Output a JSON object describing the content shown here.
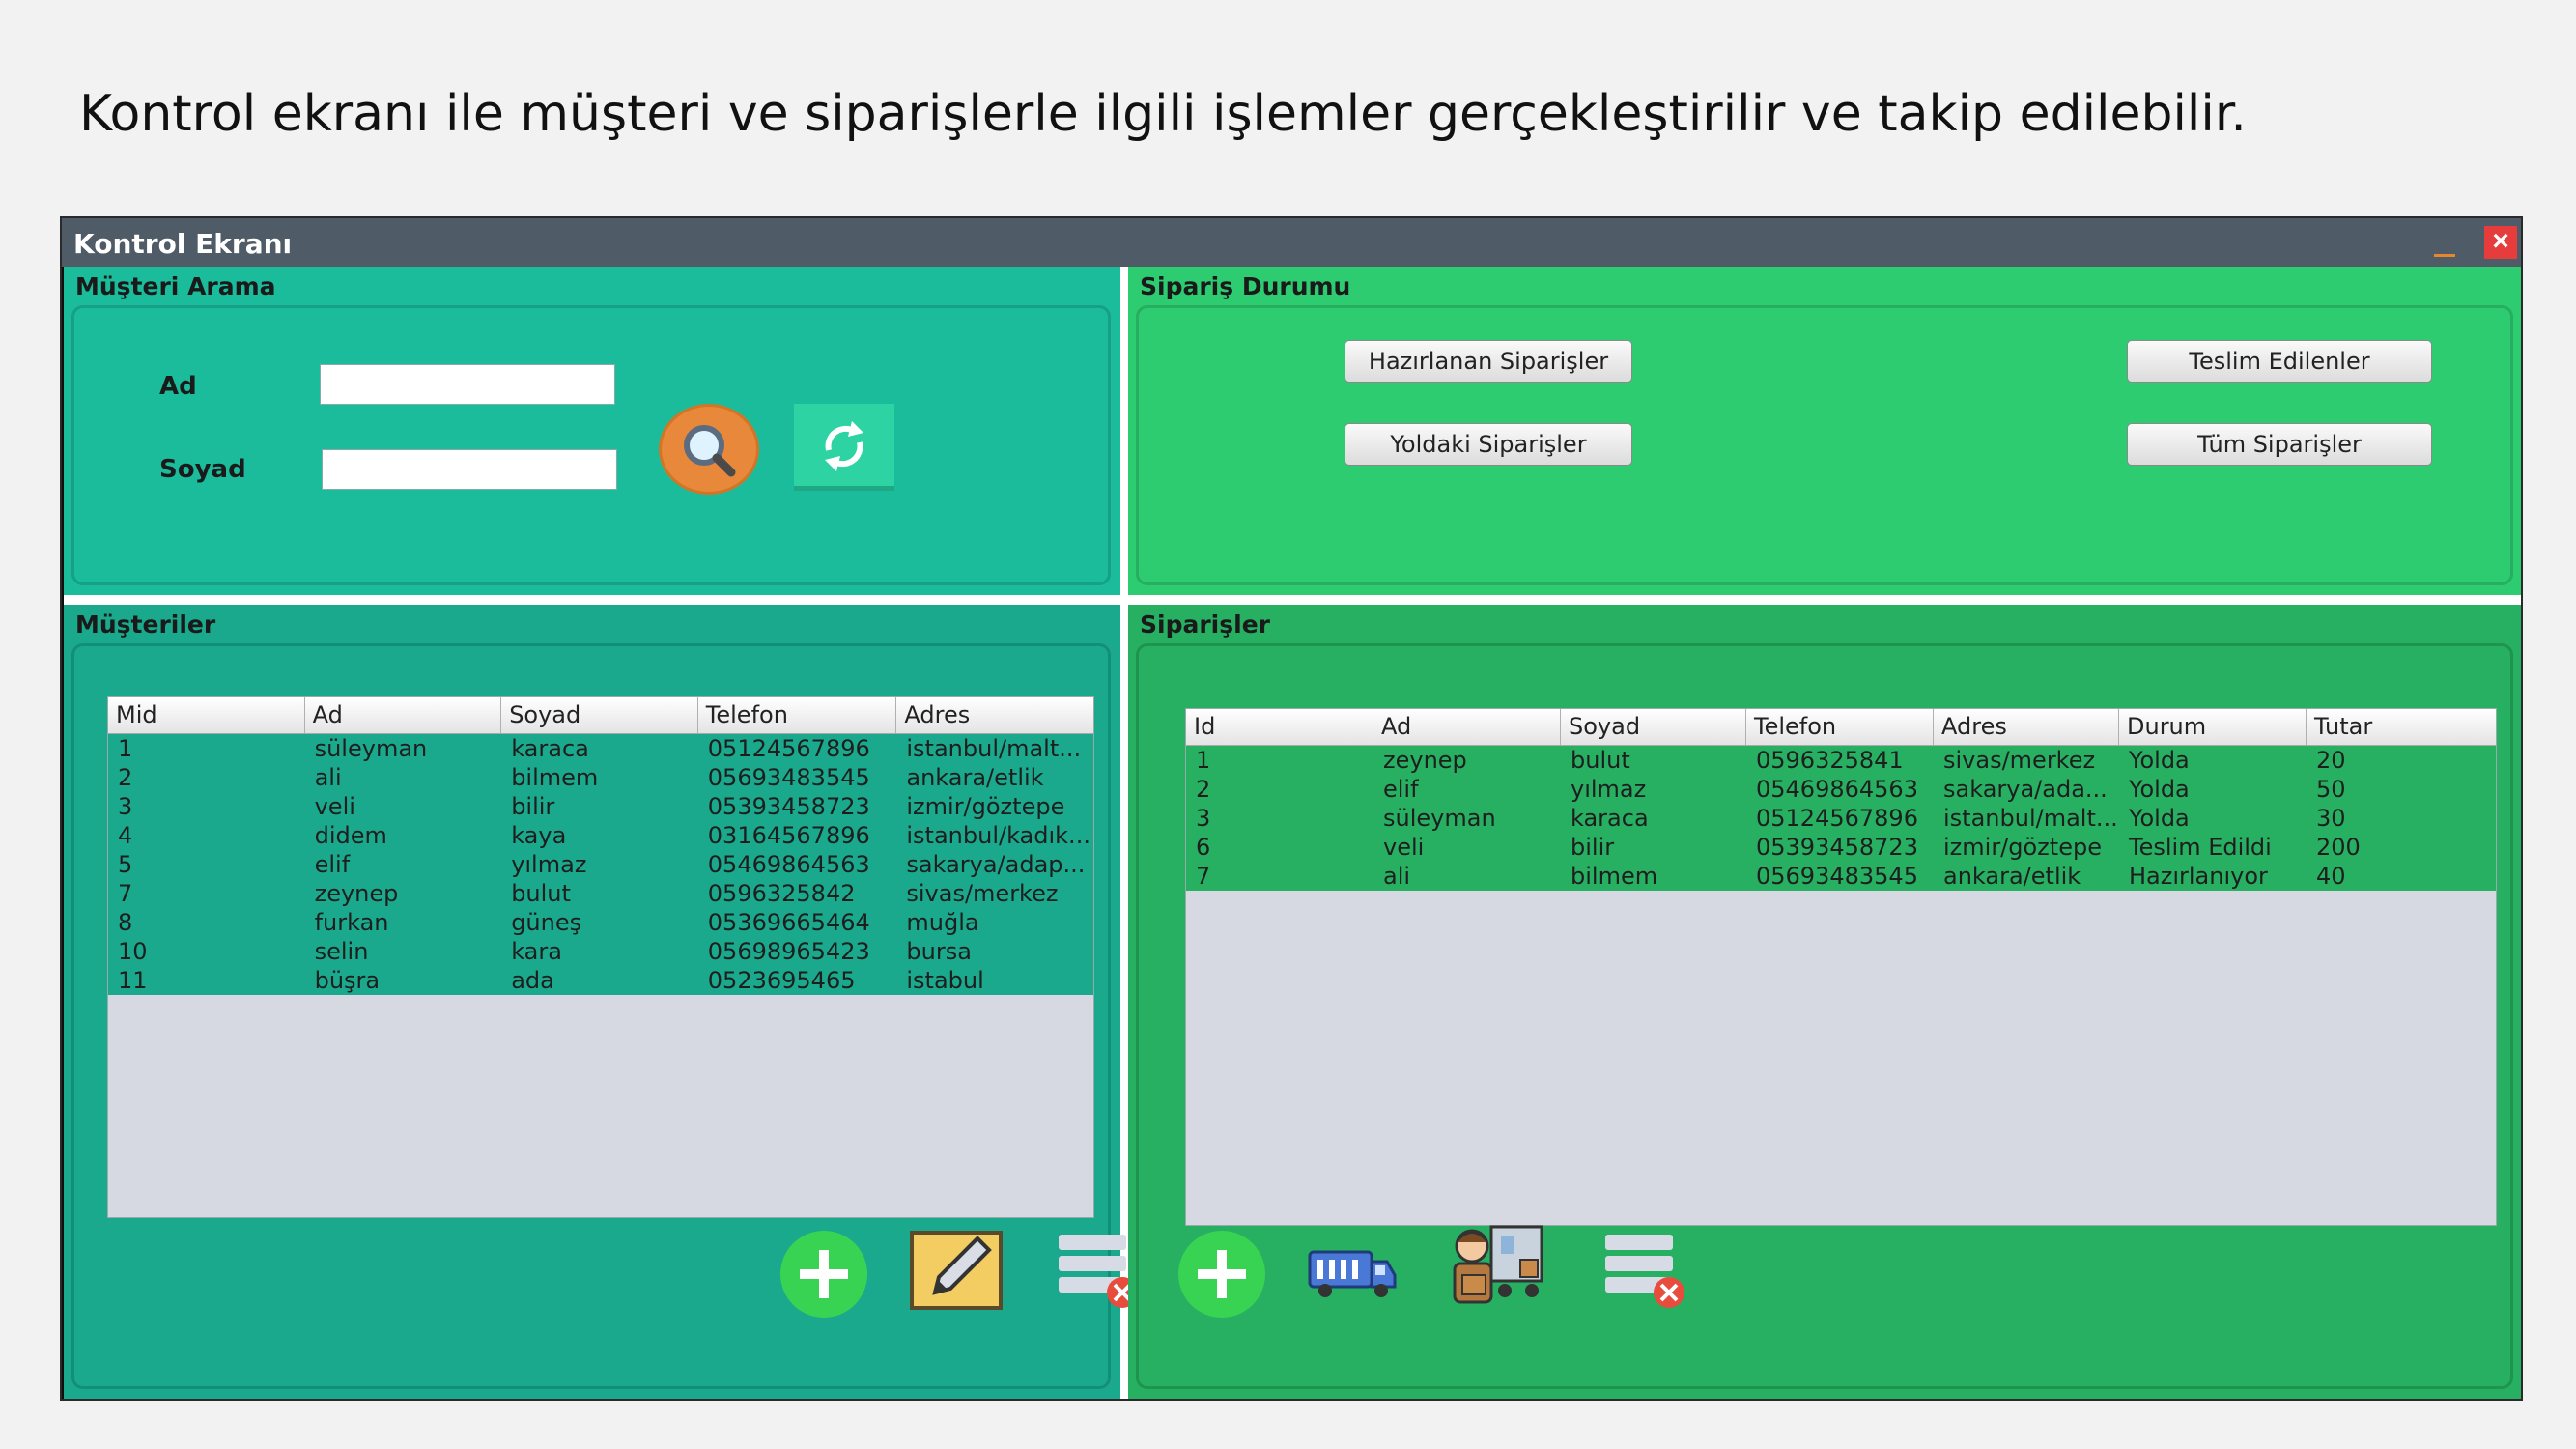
{
  "caption": "Kontrol ekranı ile müşteri ve siparişlerle ilgili işlemler gerçekleştirilir ve takip edilebilir.",
  "window": {
    "title": "Kontrol Ekranı",
    "close_label": "×"
  },
  "search_panel": {
    "title": "Müşteri Arama",
    "ad_label": "Ad",
    "soyad_label": "Soyad",
    "ad_value": "",
    "soyad_value": "",
    "search_icon": "magnifier-icon",
    "refresh_icon": "refresh-icon"
  },
  "status_panel": {
    "title": "Sipariş Durumu",
    "buttons": [
      "Hazırlanan Siparişler",
      "Teslim Edilenler",
      "Yoldaki Siparişler",
      "Tüm Siparişler"
    ]
  },
  "customers_panel": {
    "title": "Müşteriler",
    "columns": [
      "Mid",
      "Ad",
      "Soyad",
      "Telefon",
      "Adres"
    ],
    "rows": [
      [
        "1",
        "süleyman",
        "karaca",
        "05124567896",
        "istanbul/malt..."
      ],
      [
        "2",
        "ali",
        "bilmem",
        "05693483545",
        "ankara/etlik"
      ],
      [
        "3",
        "veli",
        "bilir",
        "05393458723",
        "izmir/göztepe"
      ],
      [
        "4",
        "didem",
        "kaya",
        "03164567896",
        "istanbul/kadık..."
      ],
      [
        "5",
        "elif",
        "yılmaz",
        "05469864563",
        "sakarya/adap..."
      ],
      [
        "7",
        "zeynep",
        "bulut",
        "0596325842",
        "sivas/merkez"
      ],
      [
        "8",
        "furkan",
        "güneş",
        "05369665464",
        "muğla"
      ],
      [
        "10",
        "selin",
        "kara",
        "05698965423",
        "bursa"
      ],
      [
        "11",
        "büşra",
        "ada",
        "0523695465",
        "istabul"
      ]
    ],
    "actions": [
      "add-icon",
      "edit-icon",
      "delete-icon"
    ]
  },
  "orders_panel": {
    "title": "Siparişler",
    "columns": [
      "Id",
      "Ad",
      "Soyad",
      "Telefon",
      "Adres",
      "Durum",
      "Tutar"
    ],
    "rows": [
      [
        "1",
        "zeynep",
        "bulut",
        "0596325841",
        "sivas/merkez",
        "Yolda",
        "20"
      ],
      [
        "2",
        "elif",
        "yılmaz",
        "05469864563",
        "sakarya/ada...",
        "Yolda",
        "50"
      ],
      [
        "3",
        "süleyman",
        "karaca",
        "05124567896",
        "istanbul/malt...",
        "Yolda",
        "30"
      ],
      [
        "6",
        "veli",
        "bilir",
        "05393458723",
        "izmir/göztepe",
        "Teslim Edildi",
        "200"
      ],
      [
        "7",
        "ali",
        "bilmem",
        "05693483545",
        "ankara/etlik",
        "Hazırlanıyor",
        "40"
      ]
    ],
    "actions": [
      "add-icon",
      "delivery-truck-icon",
      "courier-icon",
      "delete-icon"
    ]
  }
}
